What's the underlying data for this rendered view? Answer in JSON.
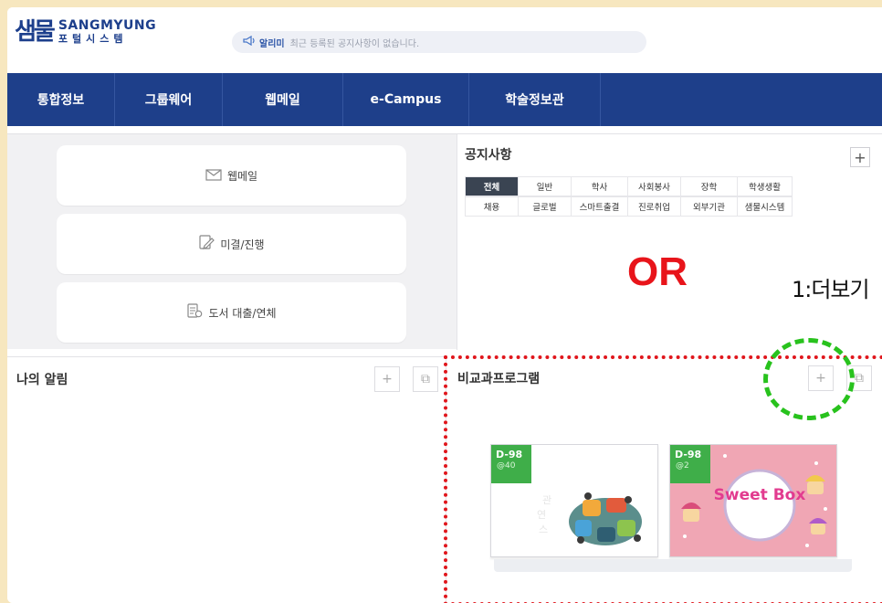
{
  "header": {
    "logo_mark": "샘물",
    "logo_en": "SANGMYUNG",
    "logo_ko": "포털시스템",
    "notice_label": "알리미",
    "notice_text": "최근 등록된 공지사항이 없습니다."
  },
  "nav": {
    "items": [
      {
        "label": "통합정보"
      },
      {
        "label": "그룹웨어"
      },
      {
        "label": "웹메일"
      },
      {
        "label": "e-Campus"
      },
      {
        "label": "학술정보관"
      }
    ]
  },
  "quick": [
    {
      "label": "웹메일",
      "icon": "envelope-icon"
    },
    {
      "label": "미결/진행",
      "icon": "edit-document-icon"
    },
    {
      "label": "도서 대출/연체",
      "icon": "book-loan-icon"
    }
  ],
  "notice_panel": {
    "title": "공지사항",
    "more": "+",
    "categories": [
      "전체",
      "일반",
      "학사",
      "사회봉사",
      "장학",
      "학생생활",
      "채용",
      "글로벌",
      "스마트출결",
      "진로취업",
      "외부기관",
      "샘물시스템"
    ],
    "active": "전체"
  },
  "annotation": {
    "or_text": "OR",
    "more_text": "1:더보기"
  },
  "alarm_panel": {
    "title": "나의 알림",
    "plus": "+",
    "popup": "⧉"
  },
  "program_panel": {
    "title": "비교과프로그램",
    "plus": "+",
    "popup": "⧉",
    "cards": [
      {
        "dday": "D-98",
        "count": "@40",
        "art": "colorful-puzzle-people"
      },
      {
        "dday": "D-98",
        "count": "@2",
        "art": "Sweet Box"
      }
    ]
  },
  "colors": {
    "nav_bg": "#1e3f8a",
    "accent_red": "#e8141a",
    "highlight_green": "#28c21d",
    "badge_green": "#3fae49"
  }
}
